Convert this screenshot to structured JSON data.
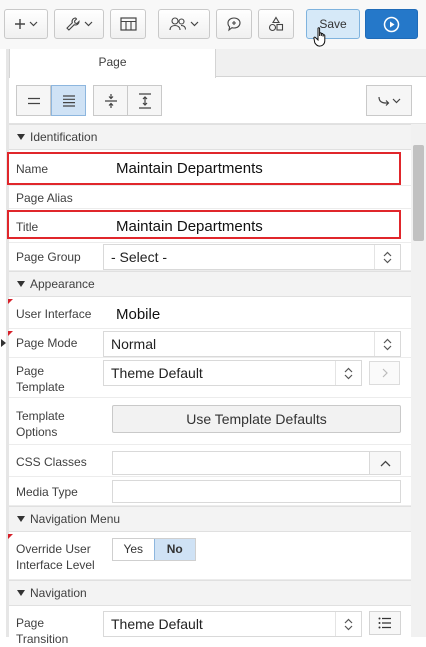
{
  "toolbar": {
    "save_label": "Save",
    "icons": [
      "plus-icon",
      "wrench-icon",
      "grid-icon",
      "users-icon",
      "comment-icon",
      "shapes-icon",
      "play-icon"
    ]
  },
  "tabs": {
    "page_label": "Page"
  },
  "sections": {
    "identification": "Identification",
    "appearance": "Appearance",
    "navigation_menu": "Navigation Menu",
    "navigation": "Navigation"
  },
  "props": {
    "name": {
      "label": "Name",
      "value": "Maintain Departments"
    },
    "page_alias": {
      "label": "Page Alias",
      "value": ""
    },
    "title": {
      "label": "Title",
      "value": "Maintain Departments"
    },
    "page_group": {
      "label": "Page Group",
      "value": "- Select -"
    },
    "user_interface": {
      "label": "User Interface",
      "value": "Mobile"
    },
    "page_mode": {
      "label": "Page Mode",
      "value": "Normal"
    },
    "page_template": {
      "label_1": "Page",
      "label_2": "Template",
      "value": "Theme Default"
    },
    "template_options": {
      "label_1": "Template",
      "label_2": "Options",
      "button": "Use Template Defaults"
    },
    "css_classes": {
      "label": "CSS Classes",
      "value": ""
    },
    "media_type": {
      "label": "Media Type",
      "value": ""
    },
    "override_ui_level": {
      "label_1": "Override User",
      "label_2": "Interface Level",
      "yes": "Yes",
      "no": "No",
      "selected": "No"
    },
    "page_transition": {
      "label_1": "Page",
      "label_2": "Transition",
      "value": "Theme Default"
    }
  },
  "colors": {
    "accent": "#2578c9",
    "highlight": "#e0262b",
    "active": "#cfe2f5"
  }
}
